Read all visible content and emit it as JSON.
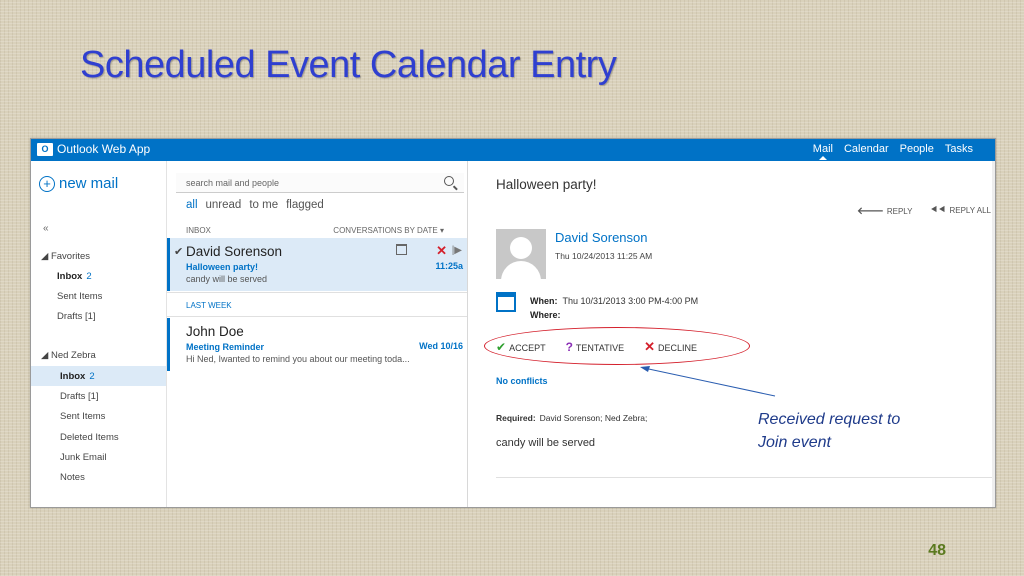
{
  "slide": {
    "title": "Scheduled Event Calendar Entry",
    "page_number": "48",
    "callout_line1": "Received request to",
    "callout_line2": "Join event"
  },
  "app": {
    "logo_text": "O",
    "name": "Outlook Web App",
    "nav": [
      "Mail",
      "Calendar",
      "People",
      "Tasks"
    ],
    "active_nav": "Mail",
    "accent_color": "#0072c6"
  },
  "folders": {
    "new_mail_label": "new mail",
    "collapse_label": "«",
    "favorites_header": "Favorites",
    "favorites": [
      {
        "label": "Inbox",
        "count": "2"
      },
      {
        "label": "Sent Items",
        "count": ""
      },
      {
        "label": "Drafts [1]",
        "count": ""
      }
    ],
    "account_header": "Ned Zebra",
    "account_folders": [
      {
        "label": "Inbox",
        "count": "2"
      },
      {
        "label": "Drafts [1]",
        "count": ""
      },
      {
        "label": "Sent Items",
        "count": ""
      },
      {
        "label": "Deleted Items",
        "count": ""
      },
      {
        "label": "Junk Email",
        "count": ""
      },
      {
        "label": "Notes",
        "count": ""
      }
    ]
  },
  "list": {
    "search_placeholder": "search mail and people",
    "filters": [
      "all",
      "unread",
      "to me",
      "flagged"
    ],
    "folder_label": "INBOX",
    "sort_label": "CONVERSATIONS BY DATE ▾",
    "section_label": "LAST WEEK",
    "messages": [
      {
        "sender": "David Sorenson",
        "subject": "Halloween party!",
        "preview": "candy will be served",
        "time": "11:25a"
      },
      {
        "sender": "John Doe",
        "subject": "Meeting Reminder",
        "preview": "Hi Ned, Iwanted to remind you about our meeting toda...",
        "time": "Wed 10/16"
      }
    ]
  },
  "reading": {
    "subject": "Halloween party!",
    "reply_label": "REPLY",
    "reply_all_label": "REPLY ALL",
    "from_name": "David Sorenson",
    "from_date": "Thu 10/24/2013 11:25 AM",
    "when_label": "When:",
    "when_value": "Thu 10/31/2013 3:00 PM-4:00 PM",
    "where_label": "Where:",
    "accept_label": "ACCEPT",
    "tentative_label": "TENTATIVE",
    "decline_label": "DECLINE",
    "conflicts": "No conflicts",
    "required_label": "Required:",
    "required_value": "David Sorenson;  Ned Zebra;",
    "body": "candy will be served"
  }
}
